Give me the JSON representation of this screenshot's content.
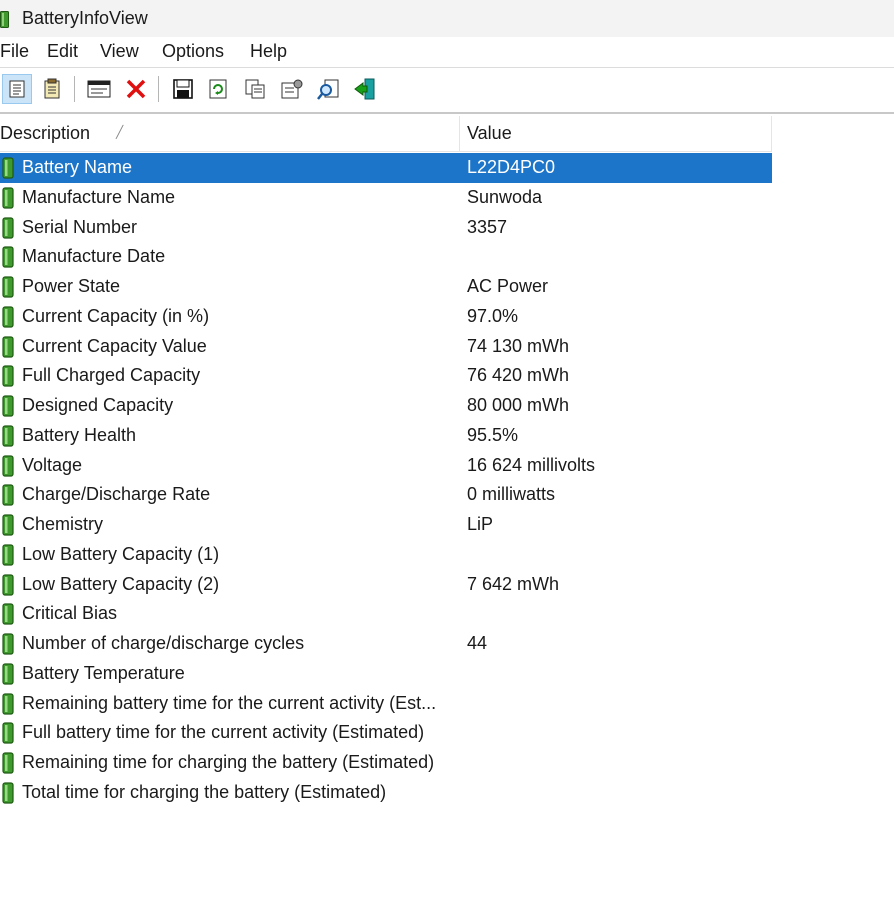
{
  "window": {
    "title": "BatteryInfoView"
  },
  "menu": [
    "File",
    "Edit",
    "View",
    "Options",
    "Help"
  ],
  "toolbar": {
    "buttons": [
      "html-report-icon",
      "text-report-icon",
      "properties-icon",
      "delete-icon",
      "save-icon",
      "refresh-icon",
      "copy-icon",
      "options-icon",
      "find-icon",
      "exit-icon"
    ]
  },
  "columns": {
    "description": "Description",
    "value": "Value"
  },
  "rows": [
    {
      "label": "Battery Name",
      "value": "L22D4PC0",
      "selected": true
    },
    {
      "label": "Manufacture Name",
      "value": "Sunwoda"
    },
    {
      "label": "Serial Number",
      "value": " 3357"
    },
    {
      "label": "Manufacture Date",
      "value": ""
    },
    {
      "label": "Power State",
      "value": "AC Power"
    },
    {
      "label": "Current Capacity (in %)",
      "value": "97.0%"
    },
    {
      "label": "Current Capacity Value",
      "value": "74 130 mWh"
    },
    {
      "label": "Full Charged Capacity",
      "value": "76 420 mWh"
    },
    {
      "label": "Designed Capacity",
      "value": "80 000 mWh"
    },
    {
      "label": "Battery Health",
      "value": "95.5%"
    },
    {
      "label": "Voltage",
      "value": "16 624 millivolts"
    },
    {
      "label": "Charge/Discharge Rate",
      "value": "0 milliwatts"
    },
    {
      "label": "Chemistry",
      "value": "LiP"
    },
    {
      "label": "Low Battery Capacity (1)",
      "value": ""
    },
    {
      "label": "Low Battery Capacity (2)",
      "value": "7 642 mWh"
    },
    {
      "label": "Critical Bias",
      "value": ""
    },
    {
      "label": "Number of charge/discharge cycles",
      "value": "44"
    },
    {
      "label": "Battery Temperature",
      "value": ""
    },
    {
      "label": "Remaining battery time for the current activity (Est...",
      "value": ""
    },
    {
      "label": "Full battery time for the current activity (Estimated)",
      "value": ""
    },
    {
      "label": "Remaining time for charging the battery (Estimated)",
      "value": ""
    },
    {
      "label": "Total  time for charging the battery (Estimated)",
      "value": ""
    }
  ],
  "colors": {
    "selection": "#1c75c9",
    "battery_green": "#3f9a2e"
  }
}
